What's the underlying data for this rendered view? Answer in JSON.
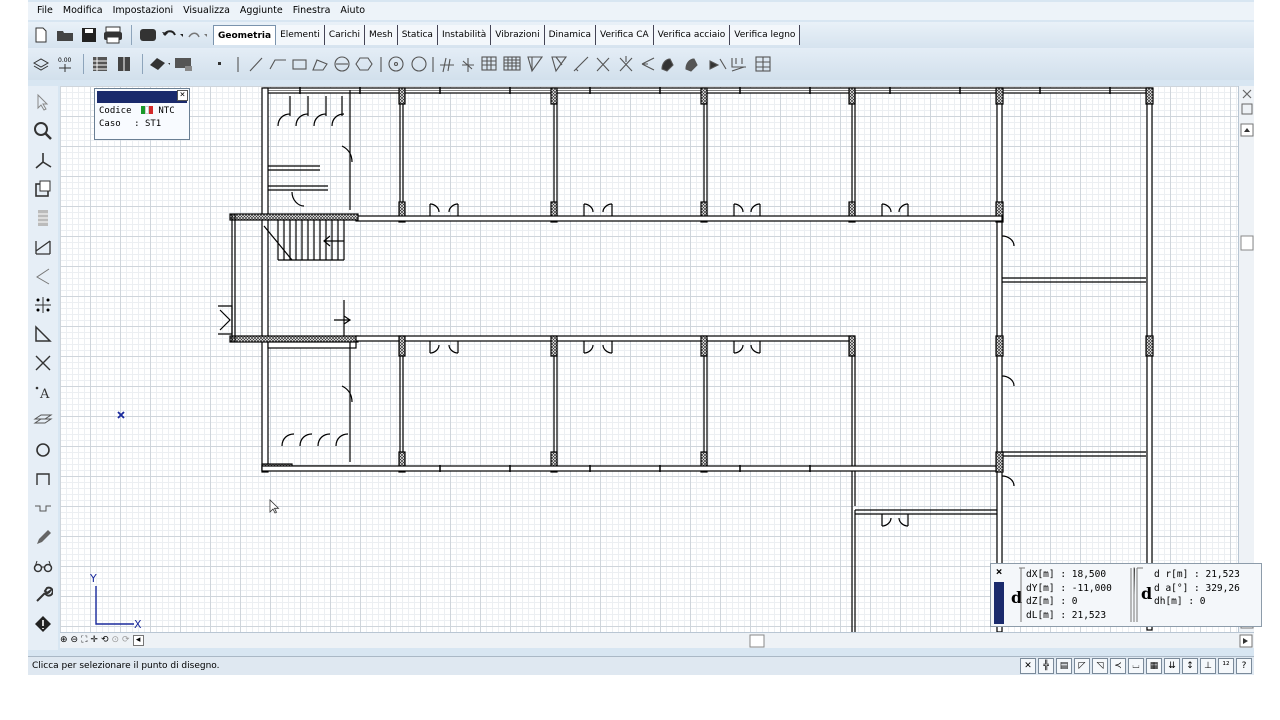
{
  "menu": [
    "File",
    "Modifica",
    "Impostazioni",
    "Visualizza",
    "Aggiunte",
    "Finestra",
    "Aiuto"
  ],
  "tabs": [
    "Geometria",
    "Elementi",
    "Carichi",
    "Mesh",
    "Statica",
    "Instabilità",
    "Vibrazioni",
    "Dinamica",
    "Verifica CA",
    "Verifica acciaio",
    "Verifica legno"
  ],
  "active_tab": "Geometria",
  "info_panel": {
    "codice_label": "Codice",
    "codice_value": "NTC",
    "caso_label": "Caso",
    "caso_value": ": ST1",
    "flag_colors": [
      "#1a9a2a",
      "#ffffff",
      "#d42a2a"
    ]
  },
  "measure_panel": {
    "dX": "dX[m] : 18,500",
    "dY": "dY[m] : -11,000",
    "dZ": "dZ[m] : 0",
    "dL": "dL[m] : 21,523",
    "dr": "d r[m] : 21,523",
    "da": "d a[°] : 329,26",
    "dh": "dh[m] : 0",
    "symbol": "d"
  },
  "axes": {
    "x_label": "X",
    "y_label": "Y"
  },
  "status": {
    "text": "Clicca per selezionare il punto di disegno."
  },
  "icons": {
    "toolbar1": [
      "new-file-icon",
      "open-folder-icon",
      "save-icon",
      "print-icon",
      "layer-icon",
      "undo-icon",
      "redo-icon"
    ],
    "toolbar2_left": [
      "layers-icon",
      "level-icon",
      "table-icon",
      "columns-icon",
      "eraser-icon",
      "display-icon"
    ],
    "drawing_tools": [
      "point-icon",
      "line-icon",
      "polyline-icon",
      "rectangle-icon",
      "polygon-icon",
      "arc-icon",
      "hexagon-icon",
      "circle-3pt-icon",
      "circle-icon",
      "grid-icon",
      "grid-alt-icon",
      "mesh-icon",
      "mesh-fill-icon",
      "slab-icon",
      "slab-alt-icon",
      "beam-icon",
      "cross-icon",
      "cross-alt-icon",
      "branch-icon",
      "hand-icon",
      "hand-alt-icon",
      "pin-icon",
      "load-icon",
      "table-grid-icon"
    ],
    "left_tools": [
      "select-arrow-icon",
      "zoom-icon",
      "axes-icon",
      "copy-icon",
      "list-icon",
      "dimension-icon",
      "angle-icon",
      "nodes-icon",
      "triangle-icon",
      "intersect-icon",
      "text-icon",
      "hatch-icon",
      "rotate-icon",
      "rect-shape-icon",
      "profile-icon",
      "pencil-icon",
      "glasses-icon",
      "wrench-icon",
      "diamond-icon"
    ]
  }
}
